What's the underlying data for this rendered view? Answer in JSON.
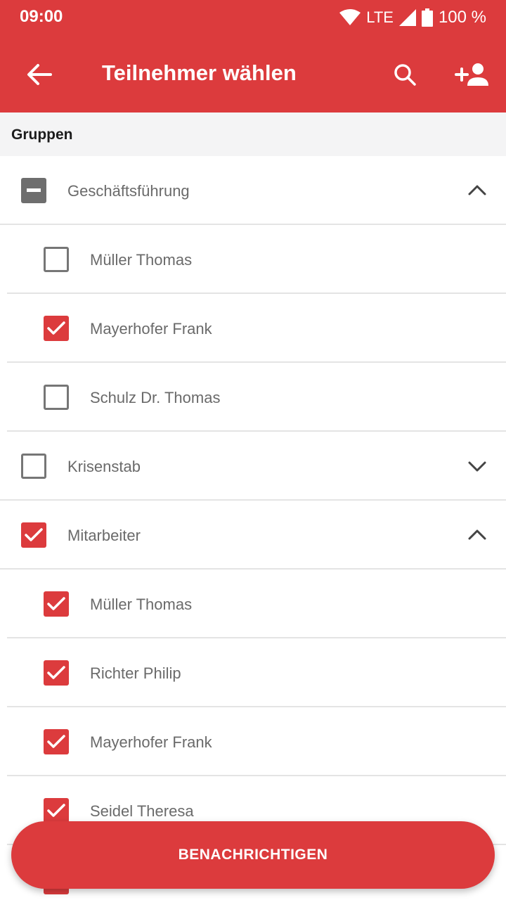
{
  "status_bar": {
    "time": "09:00",
    "network": "LTE",
    "battery": "100 %"
  },
  "toolbar": {
    "title": "Teilnehmer wählen",
    "back_icon": "arrow-left-icon",
    "search_icon": "search-icon",
    "add_icon": "add-person-icon"
  },
  "section": {
    "title": "Gruppen"
  },
  "groups": [
    {
      "name": "Geschäftsführung",
      "state": "indeterminate",
      "expanded": true,
      "members": [
        {
          "name": "Müller Thomas",
          "checked": false
        },
        {
          "name": "Mayerhofer Frank",
          "checked": true
        },
        {
          "name": "Schulz Dr. Thomas",
          "checked": false
        }
      ]
    },
    {
      "name": "Krisenstab",
      "state": "unchecked",
      "expanded": false,
      "members": []
    },
    {
      "name": "Mitarbeiter",
      "state": "checked",
      "expanded": true,
      "members": [
        {
          "name": "Müller Thomas",
          "checked": true
        },
        {
          "name": "Richter Philip",
          "checked": true
        },
        {
          "name": "Mayerhofer Frank",
          "checked": true
        },
        {
          "name": "Seidel Theresa",
          "checked": true
        }
      ]
    }
  ],
  "action": {
    "label": "BENACHRICHTIGEN"
  },
  "colors": {
    "primary": "#dc3b3d",
    "unchecked": "#767676",
    "indeterminate": "#6e6e6e"
  }
}
